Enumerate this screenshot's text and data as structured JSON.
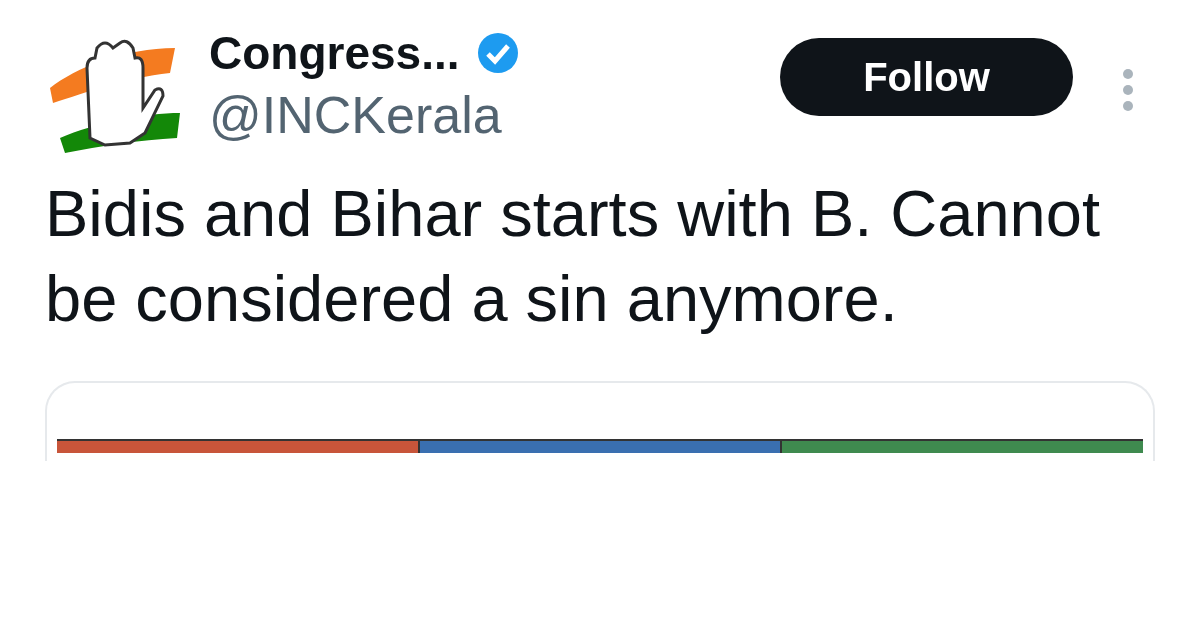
{
  "account": {
    "name": "Congress...",
    "verified": true,
    "handle": "@INCKerala"
  },
  "follow_button": {
    "label": "Follow"
  },
  "tweet": {
    "text": "Bidis and Bihar starts with B. Cannot be considered a sin anymore."
  }
}
